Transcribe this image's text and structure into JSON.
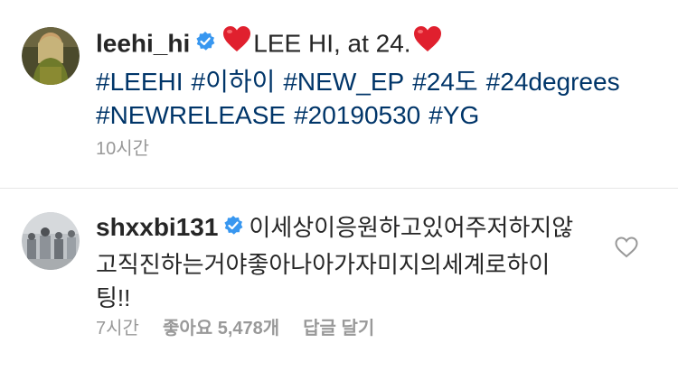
{
  "post": {
    "username": "leehi_hi",
    "caption": "LEE HI, at 24.",
    "hashtags": [
      "#LEEHI",
      "#이하이",
      "#NEW_EP",
      "#24도",
      "#24degrees",
      "#NEWRELEASE",
      "#20190530",
      "#YG"
    ],
    "time": "10시간"
  },
  "comment": {
    "username": "shxxbi131",
    "text_line1": "이세상이응원하고있어주저하지않",
    "text_line2": "고직진하는거야좋아나아가자미지의세계로하이",
    "text_line3": "팅!!",
    "time": "7시간",
    "likes": "좋아요 5,478개",
    "reply_label": "답글 달기"
  },
  "colors": {
    "hashtag": "#003569",
    "verified": "#3897f0",
    "heart": "#ed4956",
    "meta": "#999999"
  },
  "icons": {
    "verified": "verified-badge-icon",
    "caption_heart": "red-heart-emoji-icon",
    "like": "heart-outline-icon"
  }
}
